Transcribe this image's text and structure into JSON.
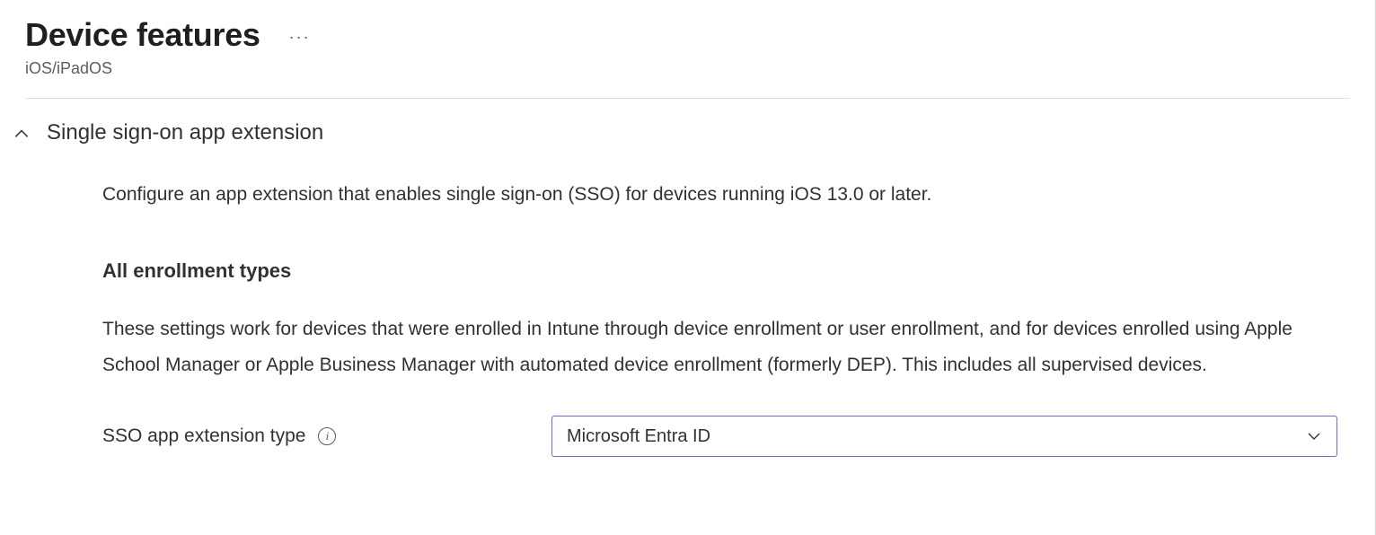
{
  "header": {
    "title": "Device features",
    "subtitle": "iOS/iPadOS"
  },
  "section": {
    "title": "Single sign-on app extension",
    "description": "Configure an app extension that enables single sign-on (SSO) for devices running iOS 13.0 or later.",
    "sub_heading": "All enrollment types",
    "sub_description": "These settings work for devices that were enrolled in Intune through device enrollment or user enrollment, and for devices enrolled using Apple School Manager or Apple Business Manager with automated device enrollment (formerly DEP). This includes all supervised devices."
  },
  "form": {
    "sso_type_label": "SSO app extension type",
    "sso_type_value": "Microsoft Entra ID"
  }
}
